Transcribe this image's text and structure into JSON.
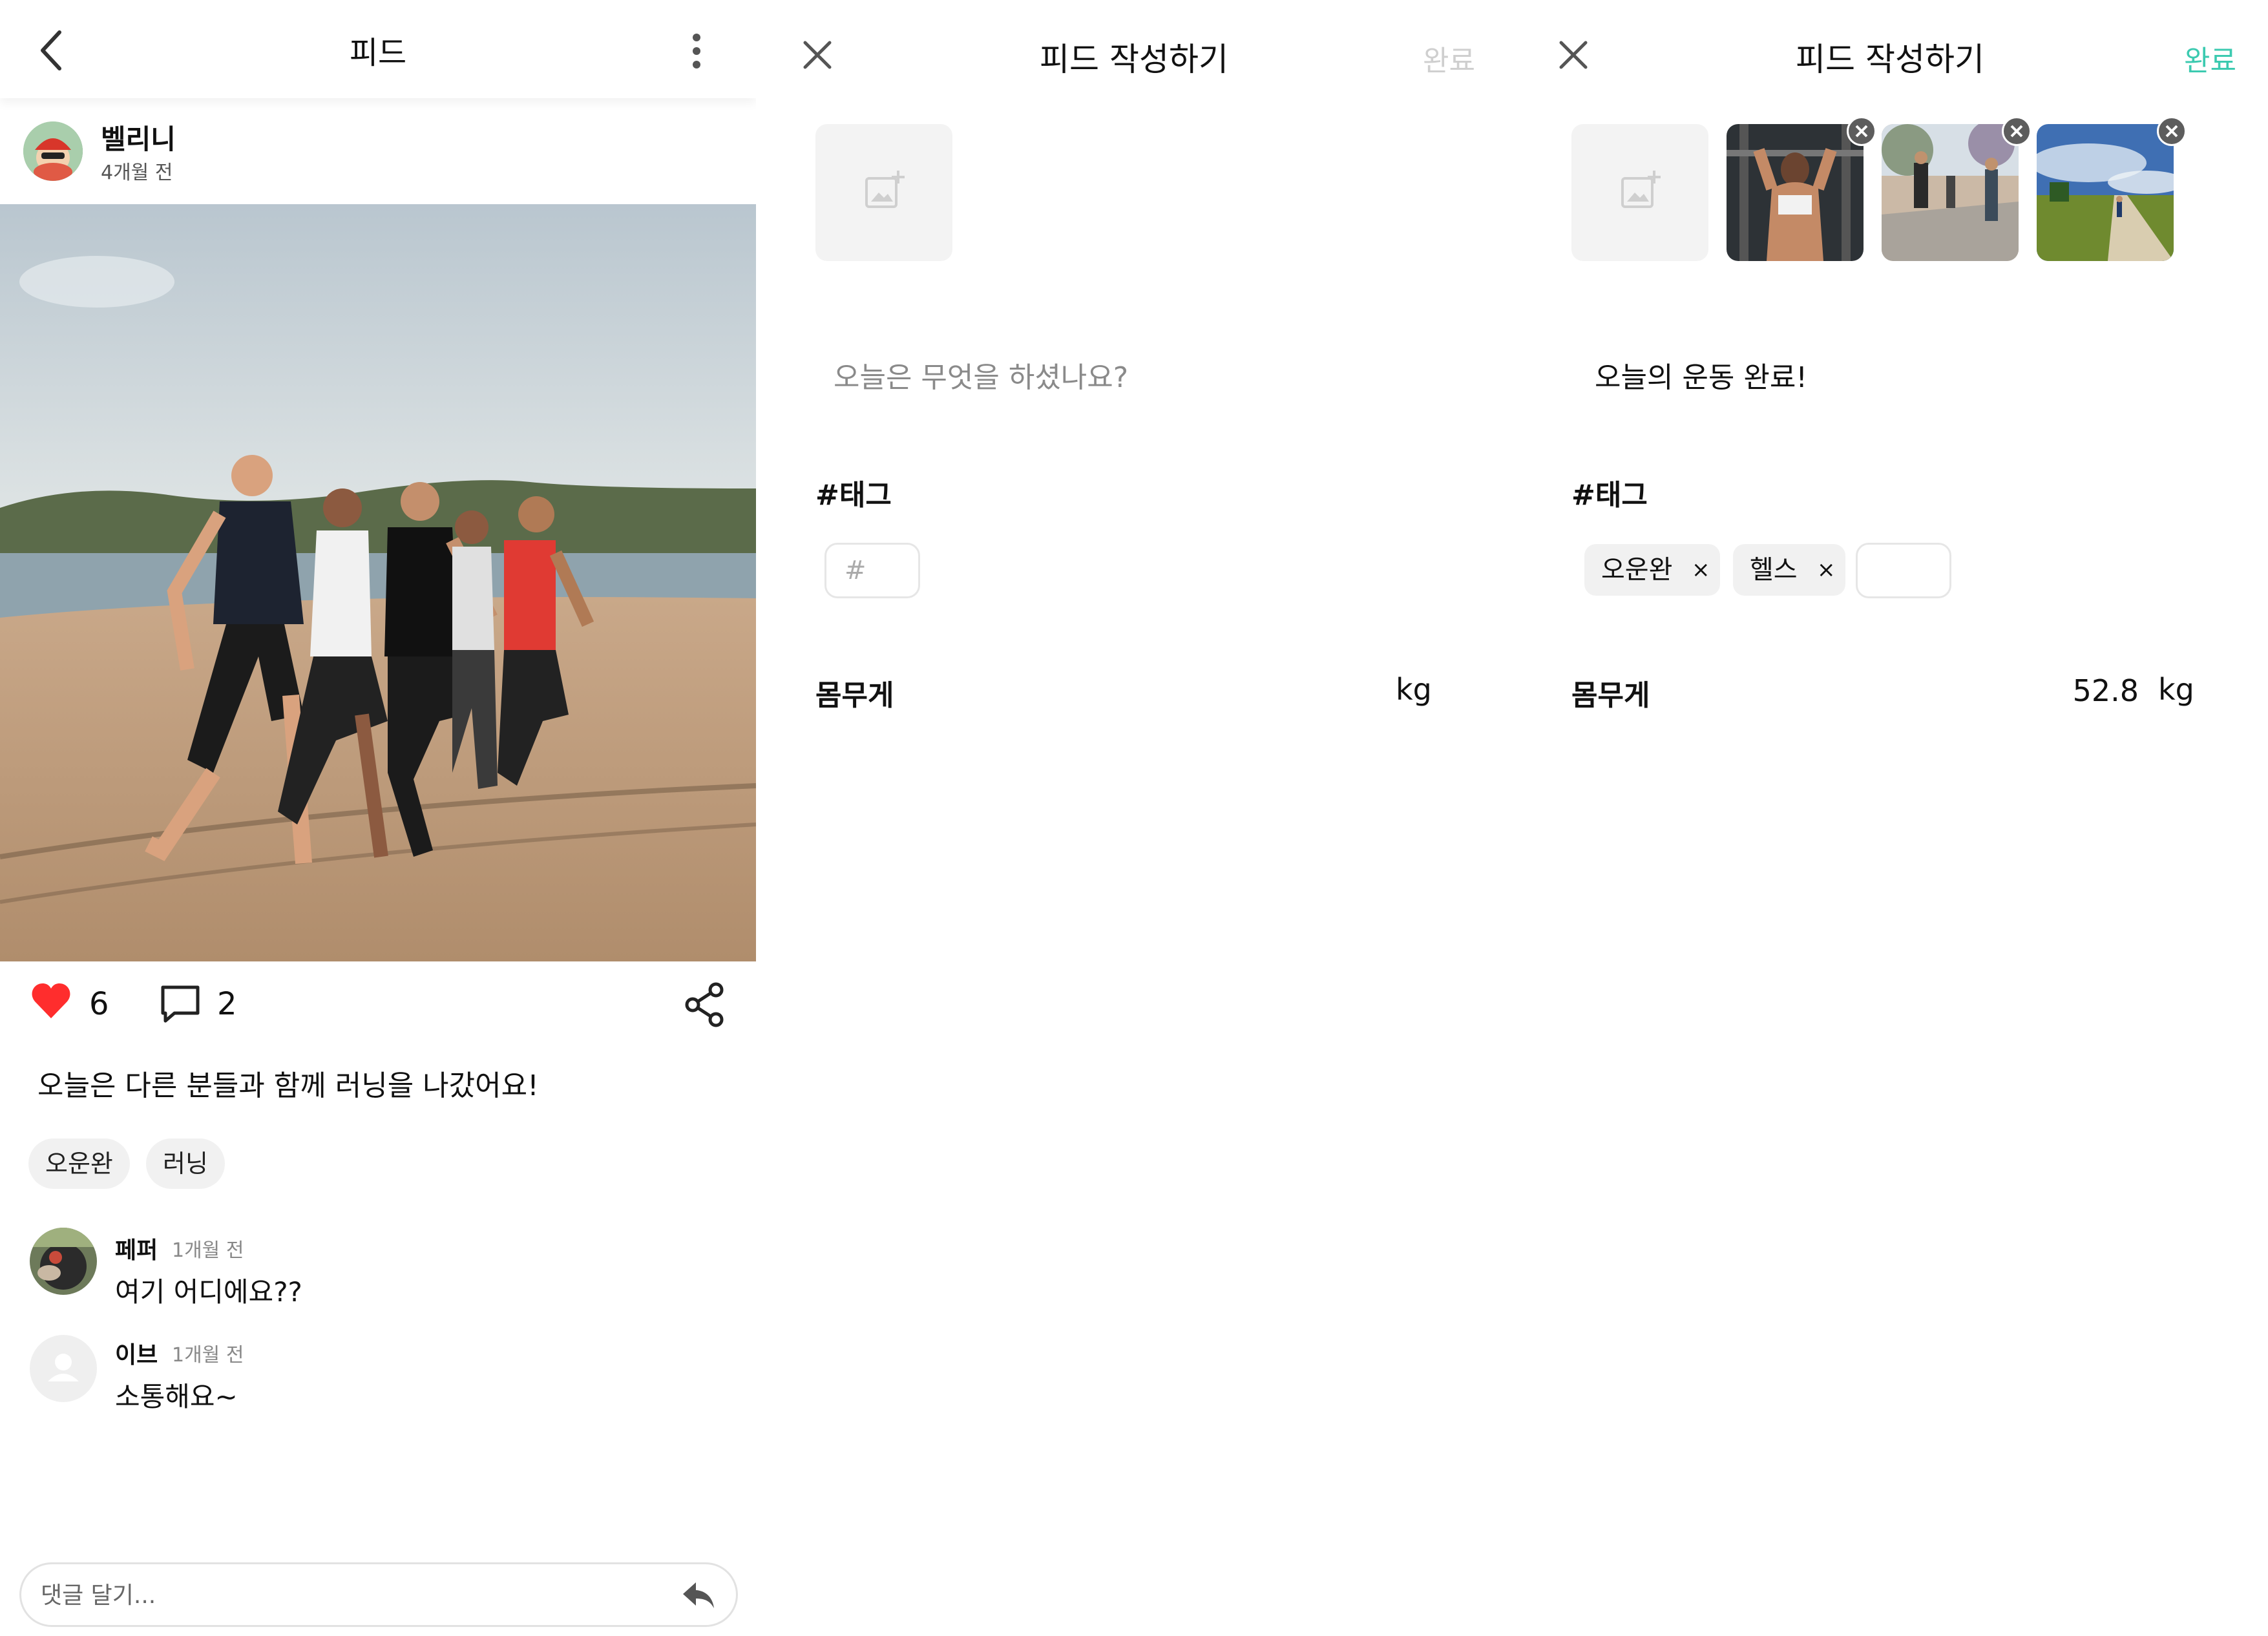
{
  "colors": {
    "heart": "#ff2d2d",
    "accent_done_active": "#3ccab0",
    "done_disabled": "#cfcfcf"
  },
  "feed_screen": {
    "header": {
      "title": "피드",
      "back_icon": "chevron-left-icon",
      "more_icon": "more-vertical-icon"
    },
    "author": {
      "name": "벨리니",
      "time": "4개월 전"
    },
    "stats": {
      "likes": "6",
      "comments": "2",
      "like_icon": "heart-icon",
      "comment_icon": "comment-icon",
      "share_icon": "share-icon"
    },
    "caption": "오늘은 다른 분들과 함께 러닝을 나갔어요!",
    "tags": [
      "오운완",
      "러닝"
    ],
    "comments": [
      {
        "name": "페퍼",
        "time": "1개월 전",
        "text": "여기 어디에요??"
      },
      {
        "name": "이브",
        "time": "1개월 전",
        "text": "소통해요~"
      }
    ],
    "comment_input": {
      "placeholder": "댓글 달기...",
      "send_icon": "reply-icon"
    }
  },
  "write_screen_empty": {
    "title": "피드 작성하기",
    "done_label": "완료",
    "content_placeholder": "오늘은 무엇을 하셨나요?",
    "tag_label": "#태그",
    "tag_input_placeholder": "#",
    "weight_label": "몸무게",
    "weight_unit": "kg"
  },
  "write_screen_filled": {
    "title": "피드 작성하기",
    "done_label": "완료",
    "content": "오늘의 운동 완료!",
    "tag_label": "#태그",
    "tags": [
      "오운완",
      "헬스"
    ],
    "tag_remove": "×",
    "weight_label": "몸무게",
    "weight_value": "52.8",
    "weight_unit": "kg",
    "photo_count": 3
  }
}
